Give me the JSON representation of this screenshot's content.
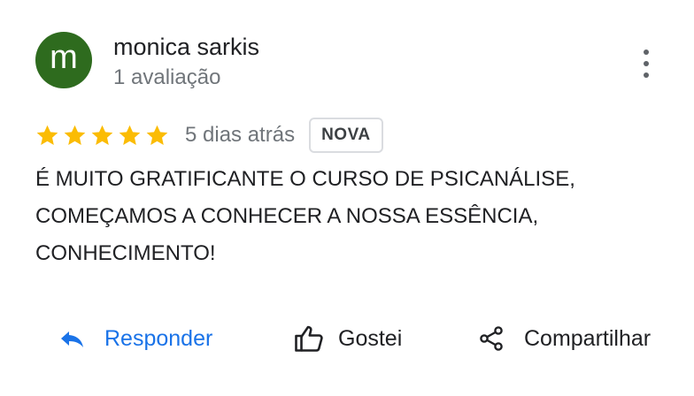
{
  "author": {
    "initial": "m",
    "name": "monica sarkis",
    "meta": "1 avaliação",
    "avatar_color": "#2e6b1e"
  },
  "menu": {
    "icon": "more-vert-icon"
  },
  "rating": {
    "stars": 5,
    "max": 5,
    "star_color": "#fbbc04",
    "date": "5 dias atrás",
    "badge": "NOVA"
  },
  "review": {
    "lines": [
      "É MUITO GRATIFICANTE O CURSO DE PSICANÁLISE,",
      "COMEÇAMOS A CONHECER A NOSSA ESSÊNCIA,",
      "CONHECIMENTO!"
    ]
  },
  "actions": {
    "reply": {
      "label": "Responder",
      "icon": "reply-icon",
      "color": "#1a73e8"
    },
    "like": {
      "label": "Gostei",
      "icon": "thumb-up-icon"
    },
    "share": {
      "label": "Compartilhar",
      "icon": "share-icon"
    }
  }
}
